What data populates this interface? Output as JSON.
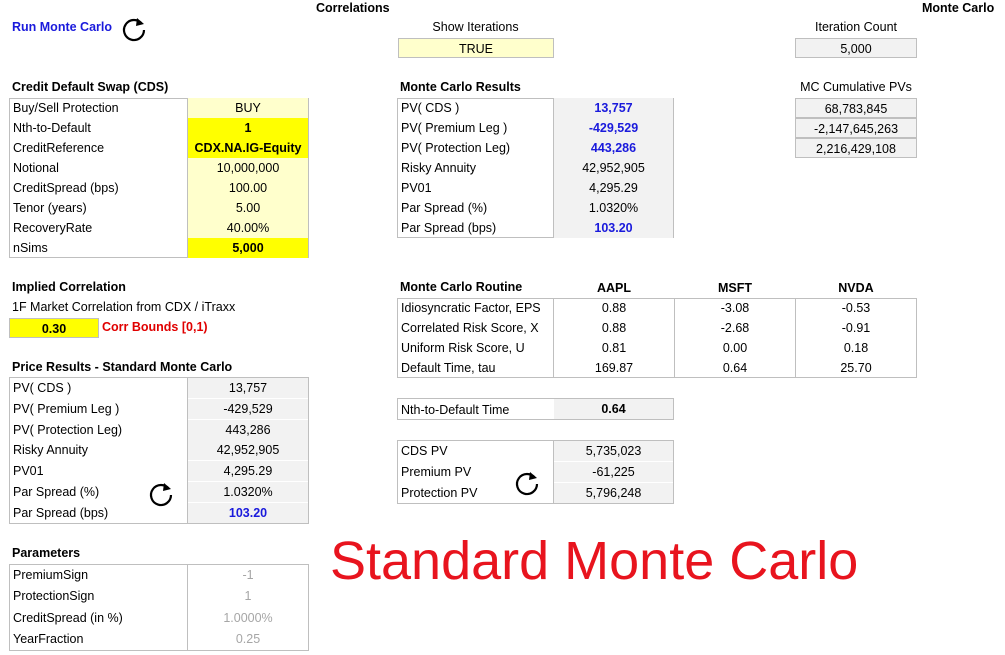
{
  "header": {
    "run_label": "Run Monte Carlo",
    "correlations": "Correlations",
    "monte_carlo": "Monte Carlo",
    "show_iterations_label": "Show Iterations",
    "show_iterations_value": "TRUE",
    "iteration_count_label": "Iteration Count",
    "iteration_count_value": "5,000"
  },
  "cds": {
    "title": "Credit Default Swap (CDS)",
    "rows": [
      {
        "label": "Buy/Sell Protection",
        "value": "BUY"
      },
      {
        "label": "Nth-to-Default",
        "value": "1"
      },
      {
        "label": "CreditReference",
        "value": "CDX.NA.IG-Equity"
      },
      {
        "label": "Notional",
        "value": "10,000,000"
      },
      {
        "label": "CreditSpread (bps)",
        "value": "100.00"
      },
      {
        "label": "Tenor (years)",
        "value": "5.00"
      },
      {
        "label": "RecoveryRate",
        "value": "40.00%"
      },
      {
        "label": "nSims",
        "value": "5,000"
      }
    ]
  },
  "implied": {
    "title": "Implied Correlation",
    "desc": "1F Market Correlation from CDX / iTraxx",
    "value": "0.30",
    "bounds": "Corr Bounds [0,1)"
  },
  "price": {
    "title": "Price Results - Standard Monte Carlo",
    "rows": [
      {
        "label": "PV( CDS )",
        "value": "13,757"
      },
      {
        "label": "PV( Premium Leg )",
        "value": "-429,529"
      },
      {
        "label": "PV( Protection Leg)",
        "value": "443,286"
      },
      {
        "label": "Risky Annuity",
        "value": "42,952,905"
      },
      {
        "label": "PV01",
        "value": "4,295.29"
      },
      {
        "label": "Par Spread (%)",
        "value": "1.0320%"
      },
      {
        "label": "Par Spread (bps)",
        "value": "103.20"
      }
    ]
  },
  "params": {
    "title": "Parameters",
    "rows": [
      {
        "label": "PremiumSign",
        "value": "-1"
      },
      {
        "label": "ProtectionSign",
        "value": "1"
      },
      {
        "label": "CreditSpread (in %)",
        "value": "1.0000%"
      },
      {
        "label": "YearFraction",
        "value": "0.25"
      }
    ]
  },
  "mc": {
    "title": "Monte Carlo Results",
    "rows": [
      {
        "label": "PV( CDS )",
        "value": "13,757"
      },
      {
        "label": "PV( Premium Leg )",
        "value": "-429,529"
      },
      {
        "label": "PV( Protection Leg)",
        "value": "443,286"
      },
      {
        "label": "Risky Annuity",
        "value": "42,952,905"
      },
      {
        "label": "PV01",
        "value": "4,295.29"
      },
      {
        "label": "Par Spread (%)",
        "value": "1.0320%"
      },
      {
        "label": "Par Spread (bps)",
        "value": "103.20"
      }
    ]
  },
  "cumulative": {
    "title": "MC Cumulative PVs",
    "values": [
      "68,783,845",
      "-2,147,645,263",
      "2,216,429,108"
    ]
  },
  "routine": {
    "title": "Monte Carlo Routine",
    "columns": [
      "AAPL",
      "MSFT",
      "NVDA"
    ],
    "rows": [
      {
        "label": "Idiosyncratic Factor, EPS",
        "values": [
          "0.88",
          "-3.08",
          "-0.53"
        ]
      },
      {
        "label": "Correlated Risk Score, X",
        "values": [
          "0.88",
          "-2.68",
          "-0.91"
        ]
      },
      {
        "label": "Uniform Risk Score, U",
        "values": [
          "0.81",
          "0.00",
          "0.18"
        ]
      },
      {
        "label": "Default Time, tau",
        "values": [
          "169.87",
          "0.64",
          "25.70"
        ]
      }
    ]
  },
  "nth": {
    "label": "Nth-to-Default Time",
    "value": "0.64"
  },
  "cdspv": {
    "rows": [
      {
        "label": "CDS PV",
        "value": "5,735,023"
      },
      {
        "label": "Premium PV",
        "value": "-61,225"
      },
      {
        "label": "Protection PV",
        "value": "5,796,248"
      }
    ]
  },
  "big_title": "Standard Monte Carlo",
  "icons": {
    "refresh": "refresh-icon"
  },
  "colors": {
    "accent_blue": "#1a1adc",
    "highlight_yellow": "#ffff00",
    "input_tan": "#ffffcc",
    "output_gray": "#f2f2f2",
    "title_red": "#e8141e"
  }
}
